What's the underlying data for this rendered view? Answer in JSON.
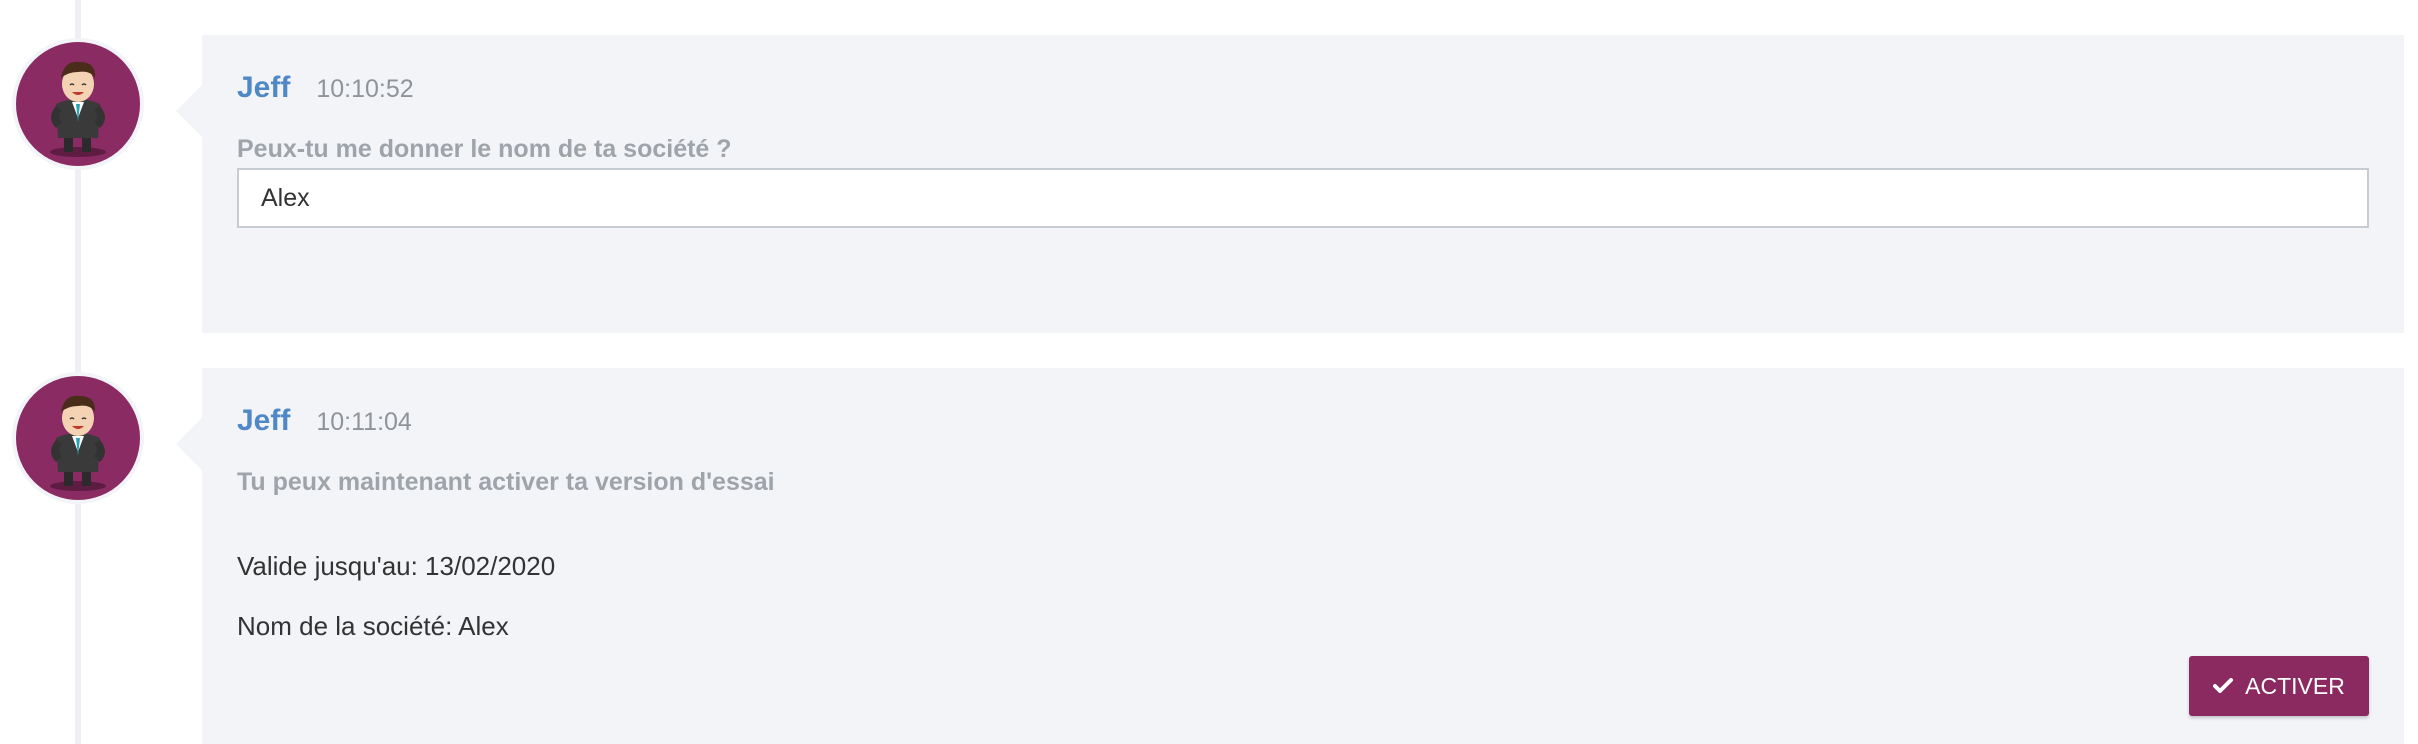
{
  "messages": [
    {
      "author": "Jeff",
      "time": "10:10:52",
      "question": "Peux-tu me donner le nom de ta société ?",
      "answer_value": "Alex"
    },
    {
      "author": "Jeff",
      "time": "10:11:04",
      "question": "Tu peux maintenant activer ta version d'essai",
      "valid_until": "Valide jusqu'au: 13/02/2020",
      "company_name": "Nom de la société: Alex",
      "button_label": "ACTIVER",
      "button_icon": "check-icon"
    }
  ],
  "colors": {
    "accent": "#8a2a61",
    "author": "#4f88c6",
    "bubble": "#f3f4f8"
  }
}
